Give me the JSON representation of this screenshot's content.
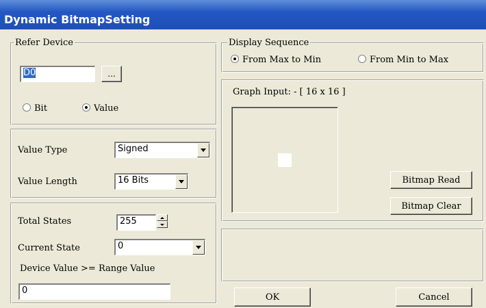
{
  "window": {
    "title": "Dynamic BitmapSetting"
  },
  "refer_device": {
    "legend": "Refer Device",
    "device_value": "D0",
    "browse_label": "...",
    "options": [
      "Bit",
      "Value"
    ],
    "selected": "Value"
  },
  "value_settings": {
    "type_label": "Value Type",
    "type_value": "Signed",
    "length_label": "Value Length",
    "length_value": "16 Bits"
  },
  "states": {
    "total_label": "Total States",
    "total_value": "255",
    "current_label": "Current State",
    "current_value": "0",
    "range_label": "Device Value >= Range Value",
    "range_value": "0"
  },
  "display_sequence": {
    "legend": "Display Sequence",
    "options": [
      "From Max to Min",
      "From Min to Max"
    ],
    "selected": "From Max to Min"
  },
  "graph": {
    "label": "Graph Input: - [ 16 x 16 ]",
    "read_button": "Bitmap Read",
    "clear_button": "Bitmap Clear"
  },
  "footer": {
    "ok_label": "OK",
    "cancel_label": "Cancel"
  },
  "colors": {
    "titlebar": "#2457c3",
    "dialog_bg": "#ece9d8",
    "selection": "#316ac5"
  }
}
